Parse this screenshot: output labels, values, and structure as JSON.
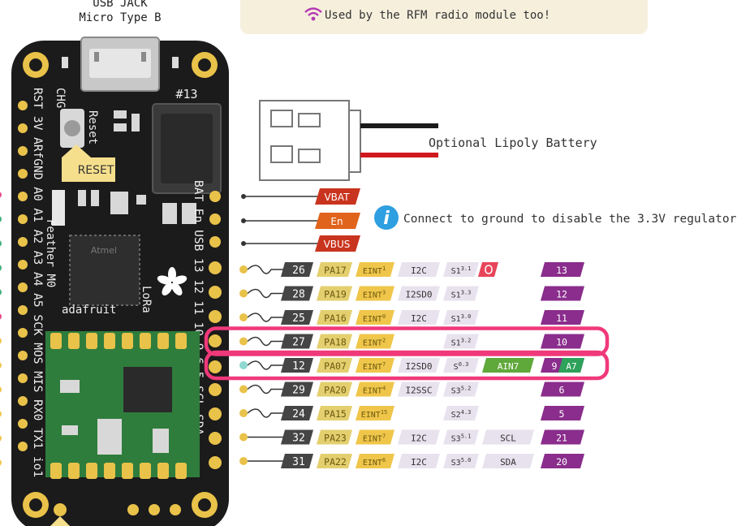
{
  "header": {
    "usb_label_line1": "USB JACK",
    "usb_label_line2": "Micro Type B",
    "radio_note": "Used by the RFM radio module too!"
  },
  "board": {
    "chg": "CHG",
    "reset_silk": "Reset",
    "reset_tag": "RESET",
    "led13": "#13",
    "left_silk": "RST 3V ARfGND A0 A1 A2 A3 A4 A5 SCK MOS MIS RX0 TX1 io1",
    "right_silk": "BAT En USB 13 12 11 10 9 6 5 SCL SDA",
    "model_line1": "Feather M0",
    "model_line2": "LoRa",
    "chip_brand": "Atmel",
    "maker": "adafruit"
  },
  "battery_label": "Optional Lipoly Battery",
  "power_pins": [
    "VBAT",
    "En",
    "VBUS"
  ],
  "en_note": "Connect to ground to disable the 3.3V regulator",
  "pin_rows": [
    {
      "num": "26",
      "port": "PA17",
      "eint": "EINT",
      "eint_sup": "1",
      "i2c": "I2C",
      "serc": "S1",
      "serc_sup": "3.1",
      "ain": "",
      "ard": "13",
      "ard_alt": "",
      "has_led": true
    },
    {
      "num": "28",
      "port": "PA19",
      "eint": "EINT",
      "eint_sup": "3",
      "i2c": "I2SD0",
      "serc": "S1",
      "serc_sup": "3.3",
      "ain": "",
      "ard": "12",
      "ard_alt": "",
      "has_led": false
    },
    {
      "num": "25",
      "port": "PA16",
      "eint": "EINT",
      "eint_sup": "0",
      "i2c": "I2C",
      "serc": "S1",
      "serc_sup": "3.0",
      "ain": "",
      "ard": "11",
      "ard_alt": "",
      "has_led": false
    },
    {
      "num": "27",
      "port": "PA18",
      "eint": "EINT",
      "eint_sup": "2",
      "i2c": "",
      "serc": "S1",
      "serc_sup": "3.2",
      "ain": "",
      "ard": "10",
      "ard_alt": "",
      "has_led": false
    },
    {
      "num": "12",
      "port": "PA07",
      "eint": "EINT",
      "eint_sup": "7",
      "i2c": "I2SD0",
      "serc": "S",
      "serc_sup": "0.3",
      "ain": "AIN7",
      "ard": "9",
      "ard_alt": "A7",
      "has_led": false
    },
    {
      "num": "29",
      "port": "PA20",
      "eint": "EINT",
      "eint_sup": "4",
      "i2c": "I2SSC",
      "serc": "S3",
      "serc_sup": "5.2",
      "ain": "",
      "ard": "6",
      "ard_alt": "",
      "has_led": false
    },
    {
      "num": "24",
      "port": "PA15",
      "eint": "EINT",
      "eint_sup": "15",
      "i2c": "",
      "serc": "S2",
      "serc_sup": "4.3",
      "ain": "",
      "ard": "5",
      "ard_alt": "",
      "has_led": false
    },
    {
      "num": "32",
      "port": "PA23",
      "eint": "EINT",
      "eint_sup": "7",
      "i2c": "I2C",
      "serc": "S3",
      "serc_sup": "5.1",
      "ain": "SCL",
      "ard": "21",
      "ard_alt": "",
      "has_led": false
    },
    {
      "num": "31",
      "port": "PA22",
      "eint": "EINT",
      "eint_sup": "6",
      "i2c": "I2C",
      "serc": "S3",
      "serc_sup": "5.0",
      "ain": "SDA",
      "ard": "20",
      "ard_alt": "",
      "has_led": false
    }
  ],
  "highlighted_rows": [
    "10",
    "9"
  ],
  "colors": {
    "board": "#1b1b1b",
    "gold": "#e9c24a",
    "power_label": "#c9341e",
    "en_label": "#e0641c",
    "pin_num": "#454545",
    "port": "#e3cf6e",
    "eint": "#f0c64a",
    "func": "#e8e2ee",
    "ain": "#5fa83a",
    "ard": "#8a2d8c",
    "highlight": "#f0397a",
    "radio_module": "#2f7d3c",
    "note_bg": "#f5efdc",
    "info": "#2e9fe0"
  }
}
